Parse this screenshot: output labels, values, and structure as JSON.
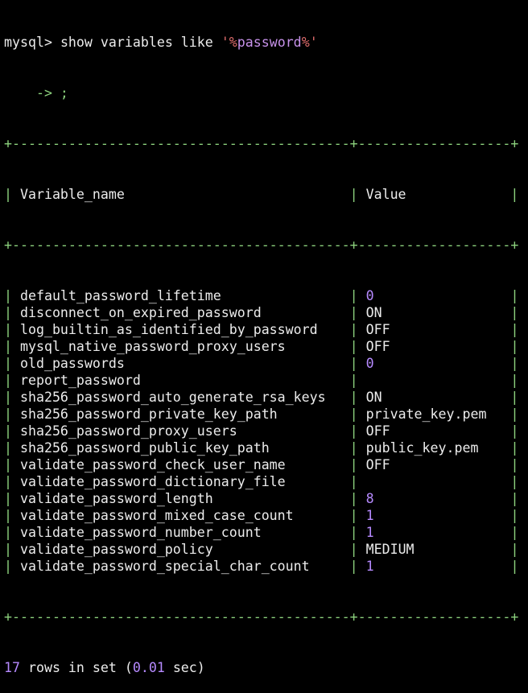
{
  "prompt": "mysql>",
  "command": {
    "before": " show variables like ",
    "quote": "'",
    "pct": "%",
    "pattern": "password"
  },
  "continuation": "    -> ;",
  "table": {
    "separator": "+------------------------------------------+-------------------+",
    "headers": [
      "Variable_name",
      "Value"
    ],
    "rows": [
      {
        "name": "default_password_lifetime",
        "value": "0",
        "numeric": true
      },
      {
        "name": "disconnect_on_expired_password",
        "value": "ON",
        "numeric": false
      },
      {
        "name": "log_builtin_as_identified_by_password",
        "value": "OFF",
        "numeric": false
      },
      {
        "name": "mysql_native_password_proxy_users",
        "value": "OFF",
        "numeric": false
      },
      {
        "name": "old_passwords",
        "value": "0",
        "numeric": true
      },
      {
        "name": "report_password",
        "value": "",
        "numeric": false
      },
      {
        "name": "sha256_password_auto_generate_rsa_keys",
        "value": "ON",
        "numeric": false
      },
      {
        "name": "sha256_password_private_key_path",
        "value": "private_key.pem",
        "numeric": false
      },
      {
        "name": "sha256_password_proxy_users",
        "value": "OFF",
        "numeric": false
      },
      {
        "name": "sha256_password_public_key_path",
        "value": "public_key.pem",
        "numeric": false
      },
      {
        "name": "validate_password_check_user_name",
        "value": "OFF",
        "numeric": false
      },
      {
        "name": "validate_password_dictionary_file",
        "value": "",
        "numeric": false
      },
      {
        "name": "validate_password_length",
        "value": "8",
        "numeric": true
      },
      {
        "name": "validate_password_mixed_case_count",
        "value": "1",
        "numeric": true
      },
      {
        "name": "validate_password_number_count",
        "value": "1",
        "numeric": true
      },
      {
        "name": "validate_password_policy",
        "value": "MEDIUM",
        "numeric": false
      },
      {
        "name": "validate_password_special_char_count",
        "value": "1",
        "numeric": true
      }
    ]
  },
  "summary": {
    "count": "17",
    "text": " rows in set (",
    "time": "0.01",
    "unit": " sec)"
  },
  "colors": {
    "background": "#000000",
    "text": "#ececec",
    "border": "#8cd17d",
    "number": "#b68aff",
    "string": "#c792ea",
    "quote": "#e06c6c"
  }
}
